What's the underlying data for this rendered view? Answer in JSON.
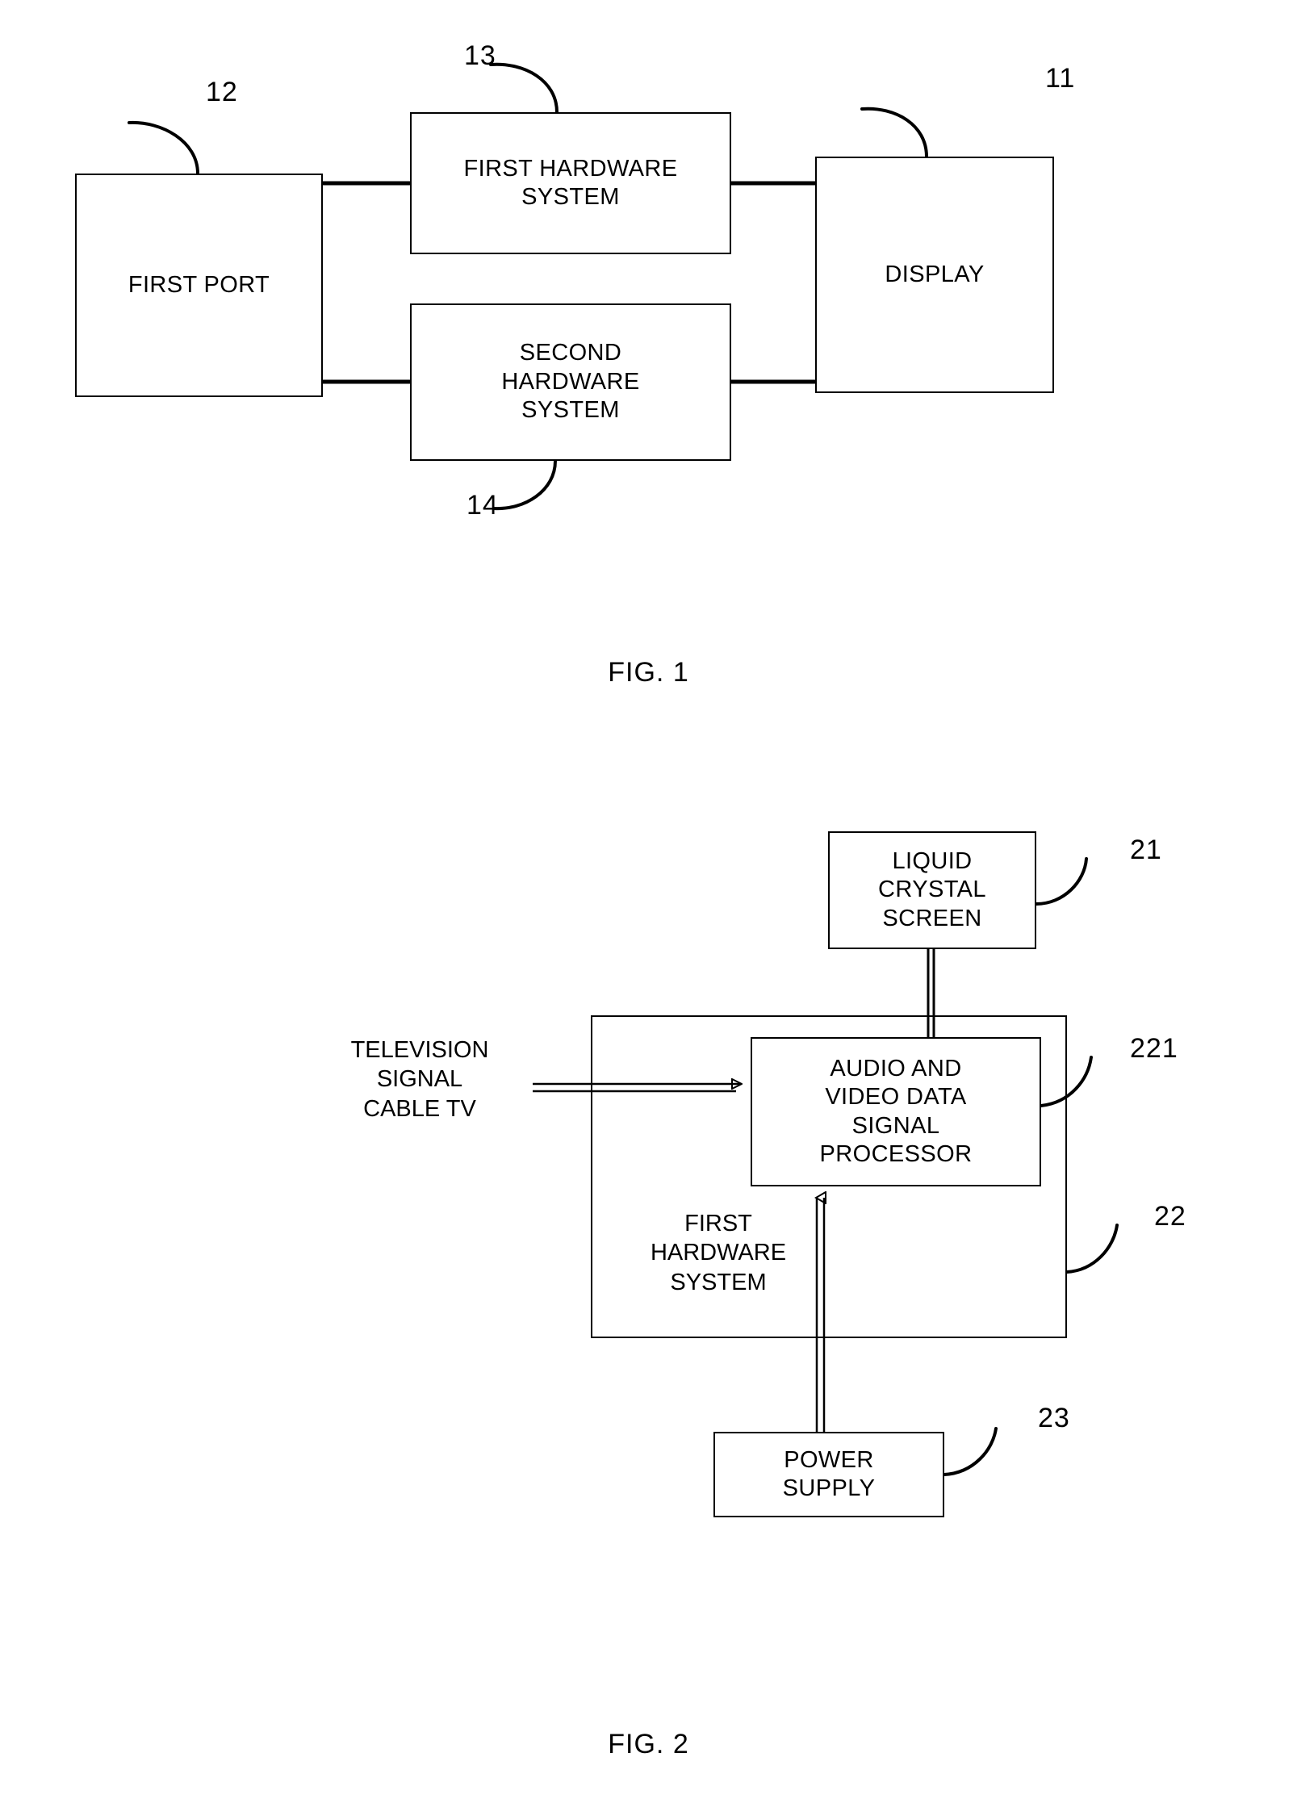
{
  "document": {
    "type": "patent-drawing-sheet",
    "figures": [
      {
        "id": "fig1",
        "caption": "FIG. 1",
        "blocks": [
          {
            "key": "first_port",
            "label": "FIRST PORT",
            "ref": "12"
          },
          {
            "key": "first_hardware",
            "label": "FIRST  HARDWARE\nSYSTEM",
            "ref": "13"
          },
          {
            "key": "second_hardware",
            "label": "SECOND\nHARDWARE\nSYSTEM",
            "ref": "14"
          },
          {
            "key": "display",
            "label": "DISPLAY",
            "ref": "11"
          }
        ],
        "connections": [
          {
            "from": "first_port",
            "to": "first_hardware"
          },
          {
            "from": "first_port",
            "to": "second_hardware"
          },
          {
            "from": "first_hardware",
            "to": "display"
          },
          {
            "from": "second_hardware",
            "to": "display"
          }
        ]
      },
      {
        "id": "fig2",
        "caption": "FIG. 2",
        "blocks": [
          {
            "key": "lcd_screen",
            "label": "LIQUID\nCRYSTAL\nSCREEN",
            "ref": "21"
          },
          {
            "key": "av_processor",
            "label": "AUDIO AND\nVIDEO DATA\nSIGNAL\nPROCESSOR",
            "ref": "221"
          },
          {
            "key": "first_hw_sys",
            "label": "FIRST\nHARDWARE\nSYSTEM",
            "ref": "22"
          },
          {
            "key": "power_supply",
            "label": "POWER\nSUPPLY",
            "ref": "23"
          }
        ],
        "input_label": "TELEVISION\nSIGNAL\nCABLE TV",
        "connections": [
          {
            "from": "tv_signal_input",
            "to": "av_processor",
            "style": "arrow"
          },
          {
            "from": "av_processor",
            "to": "lcd_screen",
            "style": "line"
          },
          {
            "from": "power_supply",
            "to": "av_processor",
            "style": "arrow"
          }
        ]
      }
    ]
  },
  "colors": {
    "ink": "#000000",
    "paper": "#ffffff"
  }
}
